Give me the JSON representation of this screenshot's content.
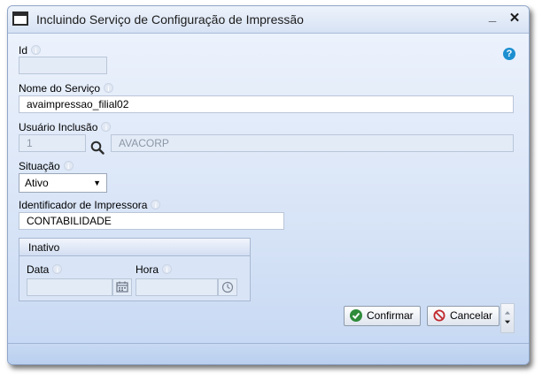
{
  "window": {
    "title": "Incluindo Serviço de Configuração de Impressão",
    "minimize_label": "_",
    "close_label": "✕"
  },
  "help_label": "?",
  "fields": {
    "id": {
      "label": "Id",
      "value": ""
    },
    "nome_servico": {
      "label": "Nome do Serviço",
      "value": "avaimpressao_filial02"
    },
    "usuario_inclusao": {
      "label": "Usuário Inclusão",
      "code": "1",
      "name": "AVACORP"
    },
    "situacao": {
      "label": "Situação",
      "value": "Ativo"
    },
    "identificador_impressora": {
      "label": "Identificador de Impressora",
      "value": "CONTABILIDADE"
    }
  },
  "inativo": {
    "title": "Inativo",
    "data_label": "Data",
    "data_value": "",
    "hora_label": "Hora",
    "hora_value": ""
  },
  "buttons": {
    "confirmar": "Confirmar",
    "cancelar": "Cancelar"
  },
  "colors": {
    "help": "#1d8fd0",
    "confirm_icon": "#2e8b3a",
    "cancel_icon": "#c0282e"
  }
}
